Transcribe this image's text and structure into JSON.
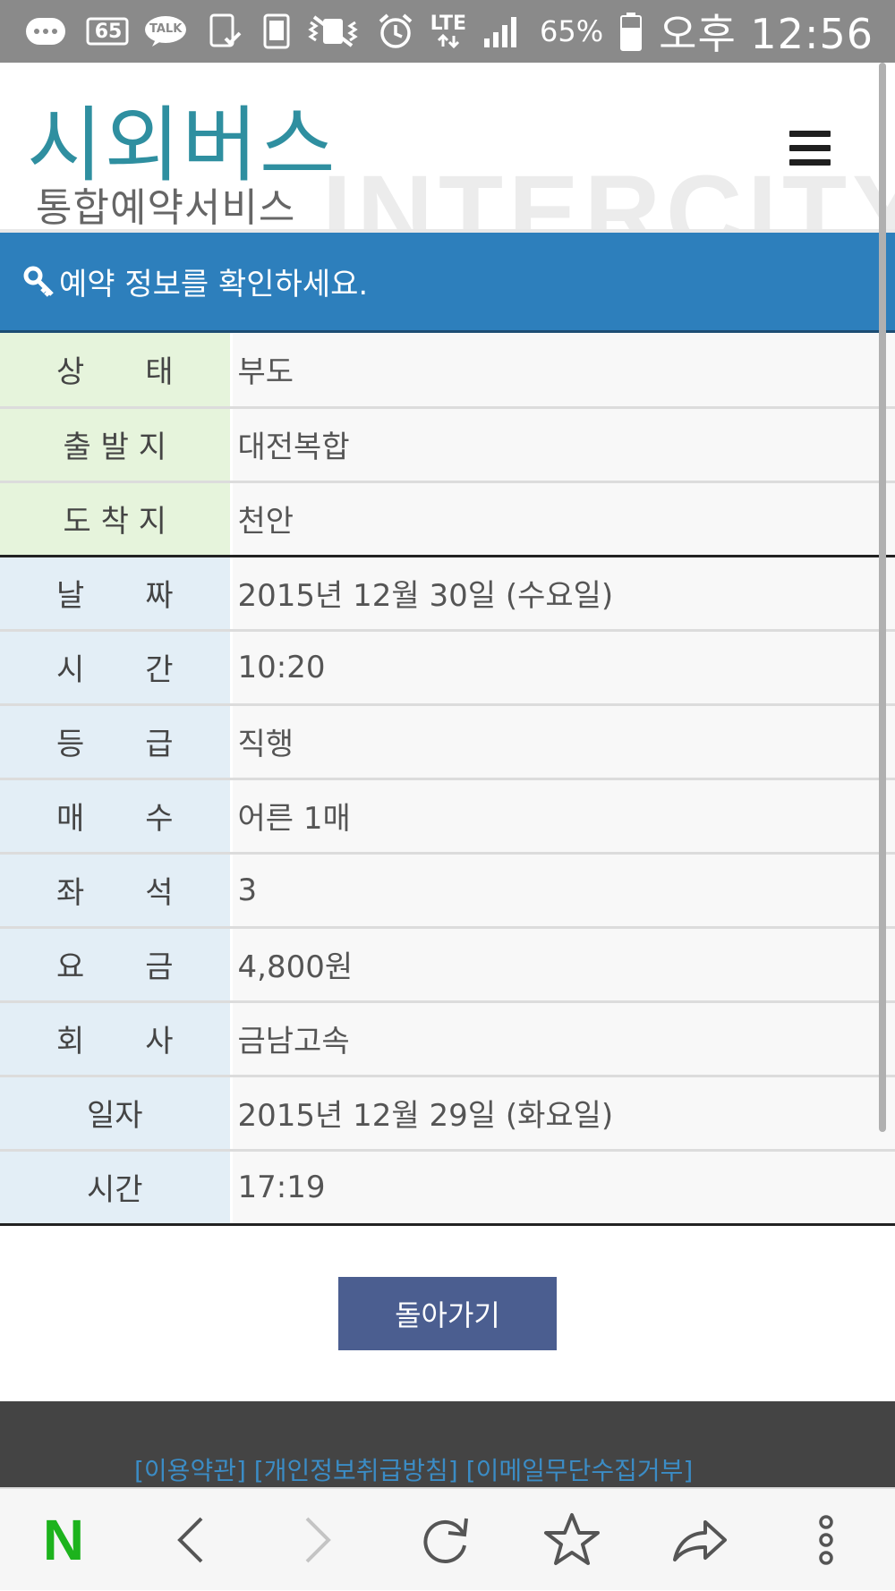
{
  "status_bar": {
    "notification_badge": "65",
    "talk_label": "TALK",
    "network": "LTE",
    "battery": "65%",
    "time": "오후 12:56"
  },
  "header": {
    "logo_main": "시외버스",
    "logo_sub": "통합예약서비스",
    "watermark": "INTERCITY"
  },
  "banner": {
    "title": "예약 정보를 확인하세요."
  },
  "reservation": {
    "rows": [
      {
        "label": "상　　태",
        "value": "부도"
      },
      {
        "label": "출 발 지",
        "value": "대전복합"
      },
      {
        "label": "도 착 지",
        "value": "천안"
      },
      {
        "label": "날　　짜",
        "value": "2015년 12월 30일 (수요일)"
      },
      {
        "label": "시　　간",
        "value": "10:20"
      },
      {
        "label": "등　　급",
        "value": "직행"
      },
      {
        "label": "매　　수",
        "value": "어른 1매"
      },
      {
        "label": "좌　　석",
        "value": "3"
      },
      {
        "label": "요　　금",
        "value": "4,800원"
      },
      {
        "label": "회　　사",
        "value": "금남고속"
      },
      {
        "label": "일자",
        "value": "2015년 12월 29일 (화요일)"
      },
      {
        "label": "시간",
        "value": "17:19"
      }
    ]
  },
  "actions": {
    "back_label": "돌아가기"
  },
  "footer": {
    "link_terms": "[이용약관]",
    "link_privacy": "[개인정보취급방침]",
    "link_email": "[이메일무단수집거부]"
  },
  "browser_nav": {
    "home_label": "N"
  },
  "colors": {
    "accent": "#2d7fbc",
    "logo": "#2f8fa0",
    "button": "#4b5e90",
    "label_green": "#e6f4dc",
    "label_blue": "#e3eef6",
    "naver_green": "#1db31d"
  }
}
